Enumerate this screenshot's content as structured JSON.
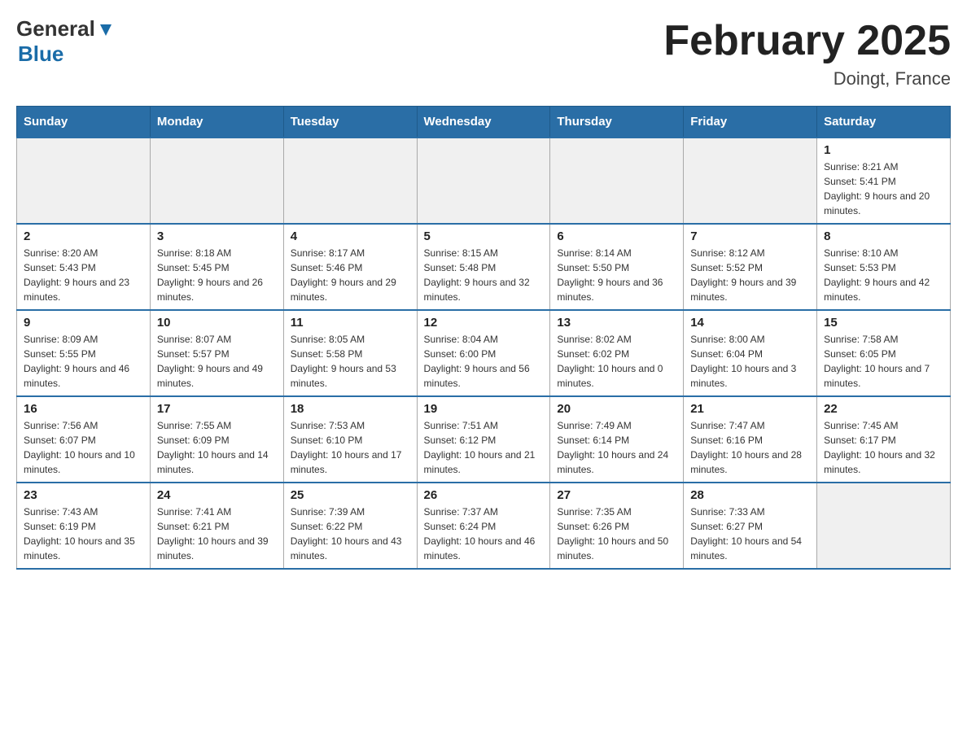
{
  "header": {
    "logo": {
      "general": "General",
      "blue": "Blue"
    },
    "title": "February 2025",
    "location": "Doingt, France"
  },
  "weekdays": [
    "Sunday",
    "Monday",
    "Tuesday",
    "Wednesday",
    "Thursday",
    "Friday",
    "Saturday"
  ],
  "weeks": [
    [
      {
        "day": "",
        "info": ""
      },
      {
        "day": "",
        "info": ""
      },
      {
        "day": "",
        "info": ""
      },
      {
        "day": "",
        "info": ""
      },
      {
        "day": "",
        "info": ""
      },
      {
        "day": "",
        "info": ""
      },
      {
        "day": "1",
        "info": "Sunrise: 8:21 AM\nSunset: 5:41 PM\nDaylight: 9 hours and 20 minutes."
      }
    ],
    [
      {
        "day": "2",
        "info": "Sunrise: 8:20 AM\nSunset: 5:43 PM\nDaylight: 9 hours and 23 minutes."
      },
      {
        "day": "3",
        "info": "Sunrise: 8:18 AM\nSunset: 5:45 PM\nDaylight: 9 hours and 26 minutes."
      },
      {
        "day": "4",
        "info": "Sunrise: 8:17 AM\nSunset: 5:46 PM\nDaylight: 9 hours and 29 minutes."
      },
      {
        "day": "5",
        "info": "Sunrise: 8:15 AM\nSunset: 5:48 PM\nDaylight: 9 hours and 32 minutes."
      },
      {
        "day": "6",
        "info": "Sunrise: 8:14 AM\nSunset: 5:50 PM\nDaylight: 9 hours and 36 minutes."
      },
      {
        "day": "7",
        "info": "Sunrise: 8:12 AM\nSunset: 5:52 PM\nDaylight: 9 hours and 39 minutes."
      },
      {
        "day": "8",
        "info": "Sunrise: 8:10 AM\nSunset: 5:53 PM\nDaylight: 9 hours and 42 minutes."
      }
    ],
    [
      {
        "day": "9",
        "info": "Sunrise: 8:09 AM\nSunset: 5:55 PM\nDaylight: 9 hours and 46 minutes."
      },
      {
        "day": "10",
        "info": "Sunrise: 8:07 AM\nSunset: 5:57 PM\nDaylight: 9 hours and 49 minutes."
      },
      {
        "day": "11",
        "info": "Sunrise: 8:05 AM\nSunset: 5:58 PM\nDaylight: 9 hours and 53 minutes."
      },
      {
        "day": "12",
        "info": "Sunrise: 8:04 AM\nSunset: 6:00 PM\nDaylight: 9 hours and 56 minutes."
      },
      {
        "day": "13",
        "info": "Sunrise: 8:02 AM\nSunset: 6:02 PM\nDaylight: 10 hours and 0 minutes."
      },
      {
        "day": "14",
        "info": "Sunrise: 8:00 AM\nSunset: 6:04 PM\nDaylight: 10 hours and 3 minutes."
      },
      {
        "day": "15",
        "info": "Sunrise: 7:58 AM\nSunset: 6:05 PM\nDaylight: 10 hours and 7 minutes."
      }
    ],
    [
      {
        "day": "16",
        "info": "Sunrise: 7:56 AM\nSunset: 6:07 PM\nDaylight: 10 hours and 10 minutes."
      },
      {
        "day": "17",
        "info": "Sunrise: 7:55 AM\nSunset: 6:09 PM\nDaylight: 10 hours and 14 minutes."
      },
      {
        "day": "18",
        "info": "Sunrise: 7:53 AM\nSunset: 6:10 PM\nDaylight: 10 hours and 17 minutes."
      },
      {
        "day": "19",
        "info": "Sunrise: 7:51 AM\nSunset: 6:12 PM\nDaylight: 10 hours and 21 minutes."
      },
      {
        "day": "20",
        "info": "Sunrise: 7:49 AM\nSunset: 6:14 PM\nDaylight: 10 hours and 24 minutes."
      },
      {
        "day": "21",
        "info": "Sunrise: 7:47 AM\nSunset: 6:16 PM\nDaylight: 10 hours and 28 minutes."
      },
      {
        "day": "22",
        "info": "Sunrise: 7:45 AM\nSunset: 6:17 PM\nDaylight: 10 hours and 32 minutes."
      }
    ],
    [
      {
        "day": "23",
        "info": "Sunrise: 7:43 AM\nSunset: 6:19 PM\nDaylight: 10 hours and 35 minutes."
      },
      {
        "day": "24",
        "info": "Sunrise: 7:41 AM\nSunset: 6:21 PM\nDaylight: 10 hours and 39 minutes."
      },
      {
        "day": "25",
        "info": "Sunrise: 7:39 AM\nSunset: 6:22 PM\nDaylight: 10 hours and 43 minutes."
      },
      {
        "day": "26",
        "info": "Sunrise: 7:37 AM\nSunset: 6:24 PM\nDaylight: 10 hours and 46 minutes."
      },
      {
        "day": "27",
        "info": "Sunrise: 7:35 AM\nSunset: 6:26 PM\nDaylight: 10 hours and 50 minutes."
      },
      {
        "day": "28",
        "info": "Sunrise: 7:33 AM\nSunset: 6:27 PM\nDaylight: 10 hours and 54 minutes."
      },
      {
        "day": "",
        "info": ""
      }
    ]
  ]
}
